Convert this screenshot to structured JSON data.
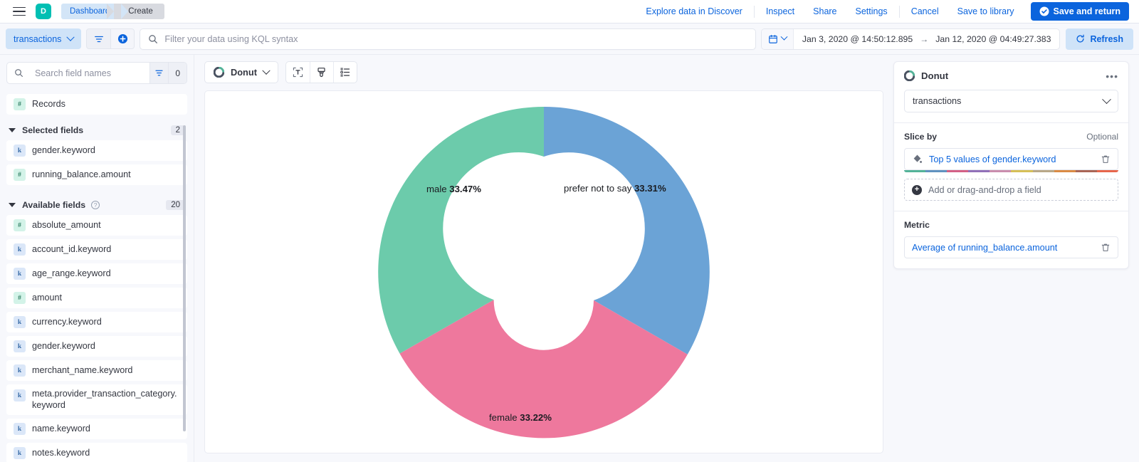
{
  "topnav": {
    "logo_letter": "D",
    "breadcrumbs": [
      {
        "label": "Dashboard",
        "active": true
      },
      {
        "label": "Create",
        "active": false
      }
    ],
    "links": [
      {
        "label": "Explore data in Discover"
      },
      {
        "label": "Inspect"
      },
      {
        "label": "Share"
      },
      {
        "label": "Settings"
      },
      {
        "label": "Cancel"
      },
      {
        "label": "Save to library"
      }
    ],
    "primary_button": "Save and return"
  },
  "querybar": {
    "dataset": "transactions",
    "search_placeholder": "Filter your data using KQL syntax",
    "search_value": "",
    "date_from": "Jan 3, 2020 @ 14:50:12.895",
    "date_to": "Jan 12, 2020 @ 04:49:27.383",
    "date_separator": "→",
    "refresh_label": "Refresh"
  },
  "fieldpanel": {
    "search_placeholder": "Search field names",
    "search_value": "",
    "filter_count": "0",
    "records_field": {
      "label": "Records",
      "type": "number"
    },
    "selected_section": {
      "title": "Selected fields",
      "count": "2"
    },
    "selected_fields": [
      {
        "label": "gender.keyword",
        "type": "string"
      },
      {
        "label": "running_balance.amount",
        "type": "number"
      }
    ],
    "available_section": {
      "title": "Available fields",
      "count": "20"
    },
    "available_fields": [
      {
        "label": "absolute_amount",
        "type": "number"
      },
      {
        "label": "account_id.keyword",
        "type": "string"
      },
      {
        "label": "age_range.keyword",
        "type": "string"
      },
      {
        "label": "amount",
        "type": "number"
      },
      {
        "label": "currency.keyword",
        "type": "string"
      },
      {
        "label": "gender.keyword",
        "type": "string"
      },
      {
        "label": "merchant_name.keyword",
        "type": "string"
      },
      {
        "label": "meta.provider_transaction_category.keyword",
        "type": "string"
      },
      {
        "label": "name.keyword",
        "type": "string"
      },
      {
        "label": "notes.keyword",
        "type": "string"
      }
    ]
  },
  "chart_toolbar": {
    "vis_type": "Donut",
    "buttons": [
      {
        "name": "labels-icon"
      },
      {
        "name": "appearance-icon"
      },
      {
        "name": "settings-icon"
      }
    ]
  },
  "config": {
    "title": "Donut",
    "dataset": "transactions",
    "slice_by": {
      "label": "Slice by",
      "optional": "Optional",
      "dimension": "Top 5 values of gender.keyword",
      "dropzone": "Add or drag-and-drop a field",
      "palette": [
        "#54b399",
        "#6092c0",
        "#d36086",
        "#9170b8",
        "#ca8eae",
        "#d6bf57",
        "#b9a888",
        "#da8b45",
        "#aa6556",
        "#e7664c"
      ]
    },
    "metric": {
      "label": "Metric",
      "dimension": "Average of running_balance.amount"
    }
  },
  "chart_data": {
    "type": "pie",
    "variant": "donut",
    "title": "Donut",
    "metric": "Average of running_balance.amount",
    "slice_by": "Top 5 values of gender.keyword",
    "categories": [
      "prefer not to say",
      "female",
      "male"
    ],
    "values": [
      33.31,
      33.22,
      33.47
    ],
    "labels": [
      {
        "name": "prefer not to say",
        "percent": "33.31%",
        "color": "#6ba3d6"
      },
      {
        "name": "female",
        "percent": "33.22%",
        "color": "#ee789d"
      },
      {
        "name": "male",
        "percent": "33.47%",
        "color": "#6ccbab"
      }
    ],
    "unit": "%",
    "start_angle_deg": 0,
    "direction": "clockwise",
    "inner_radius_ratio": 0.3,
    "legend": "none",
    "grid": false
  }
}
